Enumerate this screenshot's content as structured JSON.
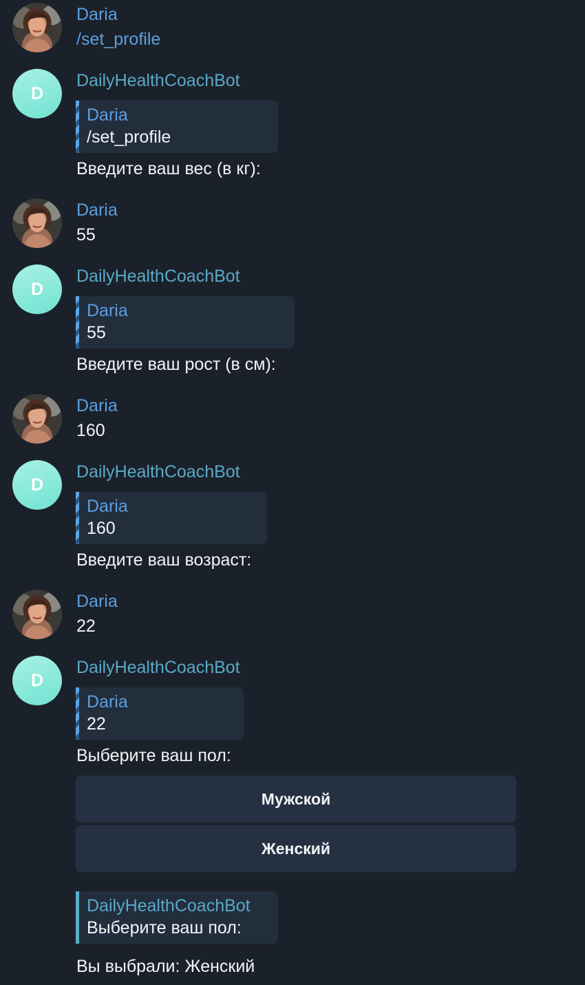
{
  "messages": [
    {
      "sender": "Daria",
      "text": "/set_profile"
    },
    {
      "sender": "DailyHealthCoachBot",
      "avatar_letter": "D",
      "reply_to": {
        "name": "Daria",
        "text": "/set_profile"
      },
      "text": "Введите ваш вес (в кг):"
    },
    {
      "sender": "Daria",
      "text": "55"
    },
    {
      "sender": "DailyHealthCoachBot",
      "avatar_letter": "D",
      "reply_to": {
        "name": "Daria",
        "text": "55"
      },
      "text": "Введите ваш рост (в см):"
    },
    {
      "sender": "Daria",
      "text": "160"
    },
    {
      "sender": "DailyHealthCoachBot",
      "avatar_letter": "D",
      "reply_to": {
        "name": "Daria",
        "text": "160"
      },
      "text": "Введите ваш возраст:"
    },
    {
      "sender": "Daria",
      "text": "22"
    },
    {
      "sender": "DailyHealthCoachBot",
      "avatar_letter": "D",
      "reply_to": {
        "name": "Daria",
        "text": "22"
      },
      "text": "Выберите ваш пол:",
      "buttons": [
        "Мужской",
        "Женский"
      ]
    },
    {
      "reply_to": {
        "name": "DailyHealthCoachBot",
        "text": "Выберите ваш пол:"
      },
      "text": "Вы выбрали: Женский"
    }
  ],
  "colors": {
    "background": "#1b212a",
    "user_name": "#5c9fe0",
    "bot_name": "#59a9c7",
    "reply_bg": "#232e3d",
    "button_bg": "#253142",
    "bot_avatar": "#72e3d2"
  },
  "icons": {
    "user_avatar": "user-photo-avatar",
    "bot_avatar": "letter-avatar"
  }
}
